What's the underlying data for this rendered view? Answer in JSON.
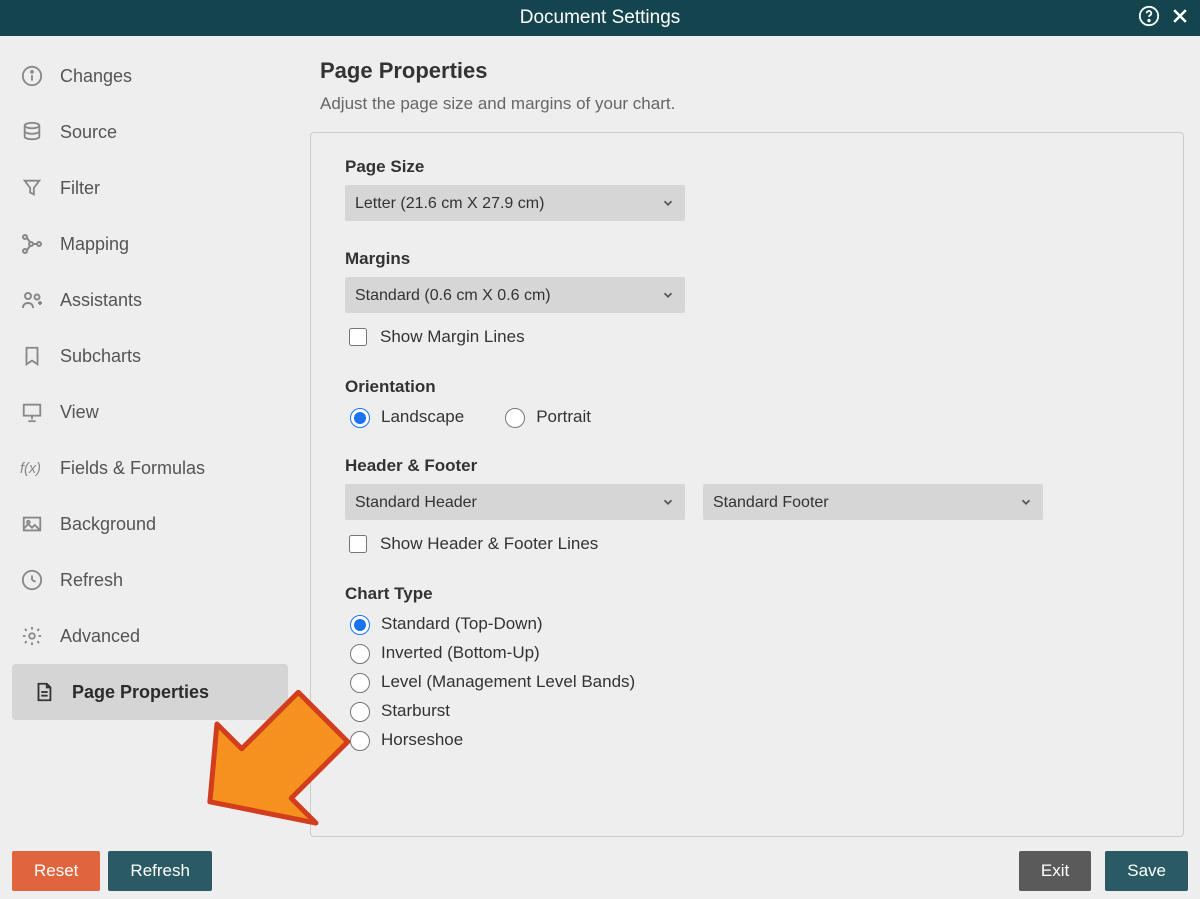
{
  "title": "Document Settings",
  "sidebar": {
    "items": [
      {
        "label": "Changes",
        "icon": "info-icon"
      },
      {
        "label": "Source",
        "icon": "database-icon"
      },
      {
        "label": "Filter",
        "icon": "filter-icon"
      },
      {
        "label": "Mapping",
        "icon": "mapping-icon"
      },
      {
        "label": "Assistants",
        "icon": "assistants-icon"
      },
      {
        "label": "Subcharts",
        "icon": "bookmark-icon"
      },
      {
        "label": "View",
        "icon": "presentation-icon"
      },
      {
        "label": "Fields & Formulas",
        "icon": "formula-icon"
      },
      {
        "label": "Background",
        "icon": "image-icon"
      },
      {
        "label": "Refresh",
        "icon": "clock-icon"
      },
      {
        "label": "Advanced",
        "icon": "gear-icon"
      },
      {
        "label": "Page Properties",
        "icon": "page-icon"
      }
    ]
  },
  "page": {
    "heading": "Page Properties",
    "subtitle": "Adjust the page size and margins of your chart.",
    "page_size": {
      "label": "Page Size",
      "value": "Letter (21.6 cm X 27.9 cm)"
    },
    "margins": {
      "label": "Margins",
      "value": "Standard (0.6 cm X 0.6 cm)",
      "show_lines": "Show Margin Lines",
      "show_lines_checked": false
    },
    "orientation": {
      "label": "Orientation",
      "landscape": "Landscape",
      "portrait": "Portrait",
      "selected": "landscape"
    },
    "header_footer": {
      "label": "Header & Footer",
      "header_value": "Standard Header",
      "footer_value": "Standard Footer",
      "show_lines": "Show Header & Footer Lines",
      "show_lines_checked": false
    },
    "chart_type": {
      "label": "Chart Type",
      "selected": 0,
      "options": [
        "Standard (Top-Down)",
        "Inverted (Bottom-Up)",
        "Level (Management Level Bands)",
        "Starburst",
        "Horseshoe"
      ]
    }
  },
  "footer": {
    "reset": "Reset",
    "refresh": "Refresh",
    "exit": "Exit",
    "save": "Save"
  }
}
